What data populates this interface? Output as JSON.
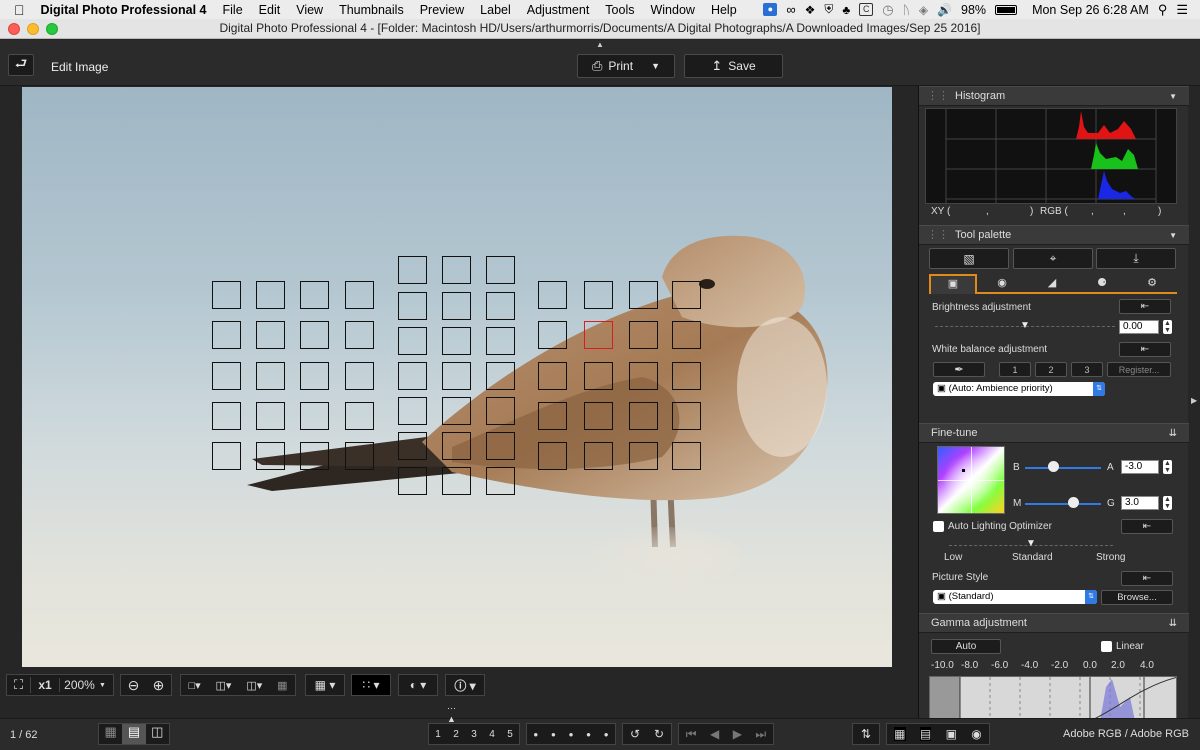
{
  "menubar": {
    "app_name": "Digital Photo Professional 4",
    "items": [
      "File",
      "Edit",
      "View",
      "Thumbnails",
      "Preview",
      "Label",
      "Adjustment",
      "Tools",
      "Window",
      "Help"
    ],
    "battery": "98%",
    "datetime": "Mon Sep 26  6:28 AM"
  },
  "window": {
    "title": "Digital Photo Professional 4 - [Folder: Macintosh HD/Users/arthurmorris/Documents/A Digital Photographs/A Downloaded Images/Sep 25 2016]"
  },
  "toolbar": {
    "mode_label": "Edit Image",
    "print_label": "Print",
    "save_label": "Save"
  },
  "viewer_toolbar": {
    "zoom_x1": "x1",
    "zoom_value": "200%"
  },
  "histogram": {
    "title": "Histogram",
    "xy_label": "XY (",
    "xy_sep1": ",",
    "xy_close": ")",
    "rgb_label": "RGB (",
    "rgb_sep1": ",",
    "rgb_sep2": ",",
    "rgb_close": ")"
  },
  "tool_palette": {
    "title": "Tool palette",
    "brightness_label": "Brightness adjustment",
    "brightness_value": "0.00",
    "brightness_level": 0.5,
    "wb_label": "White balance adjustment",
    "wb_slots": [
      "1",
      "2",
      "3"
    ],
    "wb_register": "Register...",
    "wb_mode": "(Auto: Ambience priority)"
  },
  "fine_tune": {
    "title": "Fine-tune",
    "b_label": "B",
    "a_label": "A",
    "a_value": "-3.0",
    "m_label": "M",
    "g_label": "G",
    "g_value": "3.0",
    "alo_label": "Auto Lighting Optimizer",
    "alo_levels": [
      "Low",
      "Standard",
      "Strong"
    ],
    "picture_style_label": "Picture Style",
    "picture_style_value": "(Standard)",
    "browse_label": "Browse..."
  },
  "gamma": {
    "title": "Gamma adjustment",
    "auto_label": "Auto",
    "linear_label": "Linear",
    "ticks": [
      "-10.0",
      "-8.0",
      "-6.0",
      "-4.0",
      "-2.0",
      "0.0",
      "2.0",
      "4.0"
    ]
  },
  "status": {
    "page_count": "1 / 62",
    "label_nums": [
      "1",
      "2",
      "3",
      "4",
      "5"
    ],
    "color_profile": "Adobe RGB / Adobe RGB"
  },
  "colors": {
    "accent_orange": "#e08a1c",
    "af_selected": "#d62020",
    "hist_red": "#e01414",
    "hist_green": "#18c21a",
    "hist_blue": "#1a28e6"
  }
}
